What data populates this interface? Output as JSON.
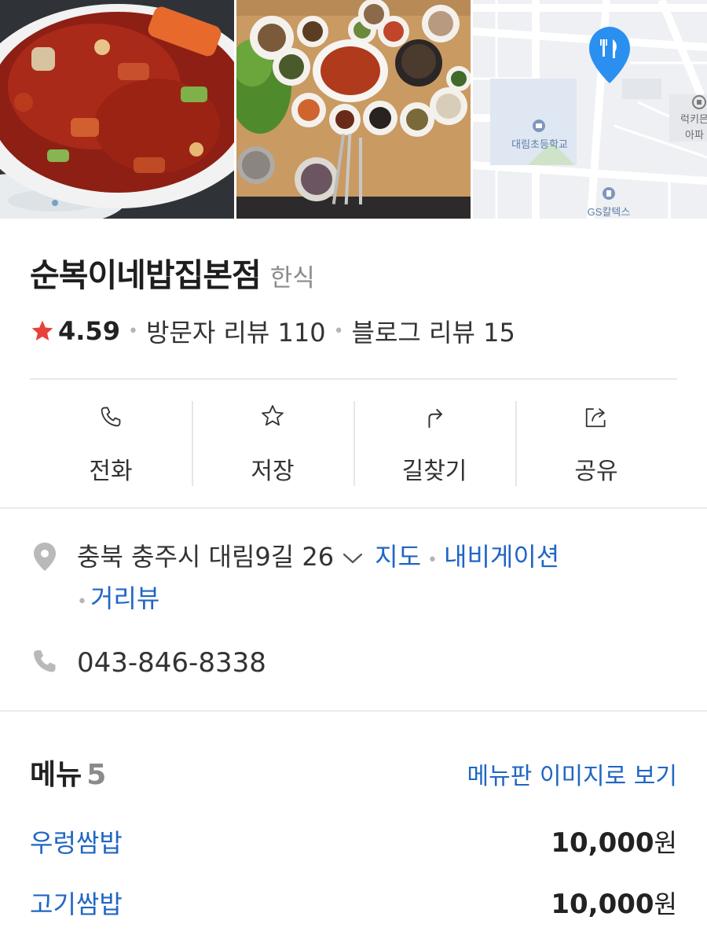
{
  "photos": {
    "map_labels": {
      "school": "대림초등학교",
      "apartment_line1": "럭키믄",
      "apartment_line2": "아파",
      "gas_station": "GS칼텍스"
    }
  },
  "place": {
    "name": "순복이네밥집본점",
    "category": "한식",
    "rating": "4.59",
    "visitor_reviews": "방문자 리뷰 110",
    "blog_reviews": "블로그 리뷰 15"
  },
  "actions": [
    {
      "label": "전화",
      "icon": "phone-icon"
    },
    {
      "label": "저장",
      "icon": "star-outline-icon"
    },
    {
      "label": "길찾기",
      "icon": "directions-arrow-icon"
    },
    {
      "label": "공유",
      "icon": "share-icon"
    }
  ],
  "info": {
    "address": "충북 충주시 대림9길 26",
    "map_link": "지도",
    "navigation_link": "내비게이션",
    "street_view_link": "거리뷰",
    "phone": "043-846-8338"
  },
  "menu": {
    "title": "메뉴",
    "count": "5",
    "view_image_link": "메뉴판 이미지로 보기",
    "items": [
      {
        "name": "우렁쌈밥",
        "price": "10,000",
        "unit": "원"
      },
      {
        "name": "고기쌈밥",
        "price": "10,000",
        "unit": "원"
      }
    ]
  },
  "colors": {
    "accent_link": "#2066c4",
    "star": "#e8413a",
    "map_pin": "#2b8ff0"
  }
}
